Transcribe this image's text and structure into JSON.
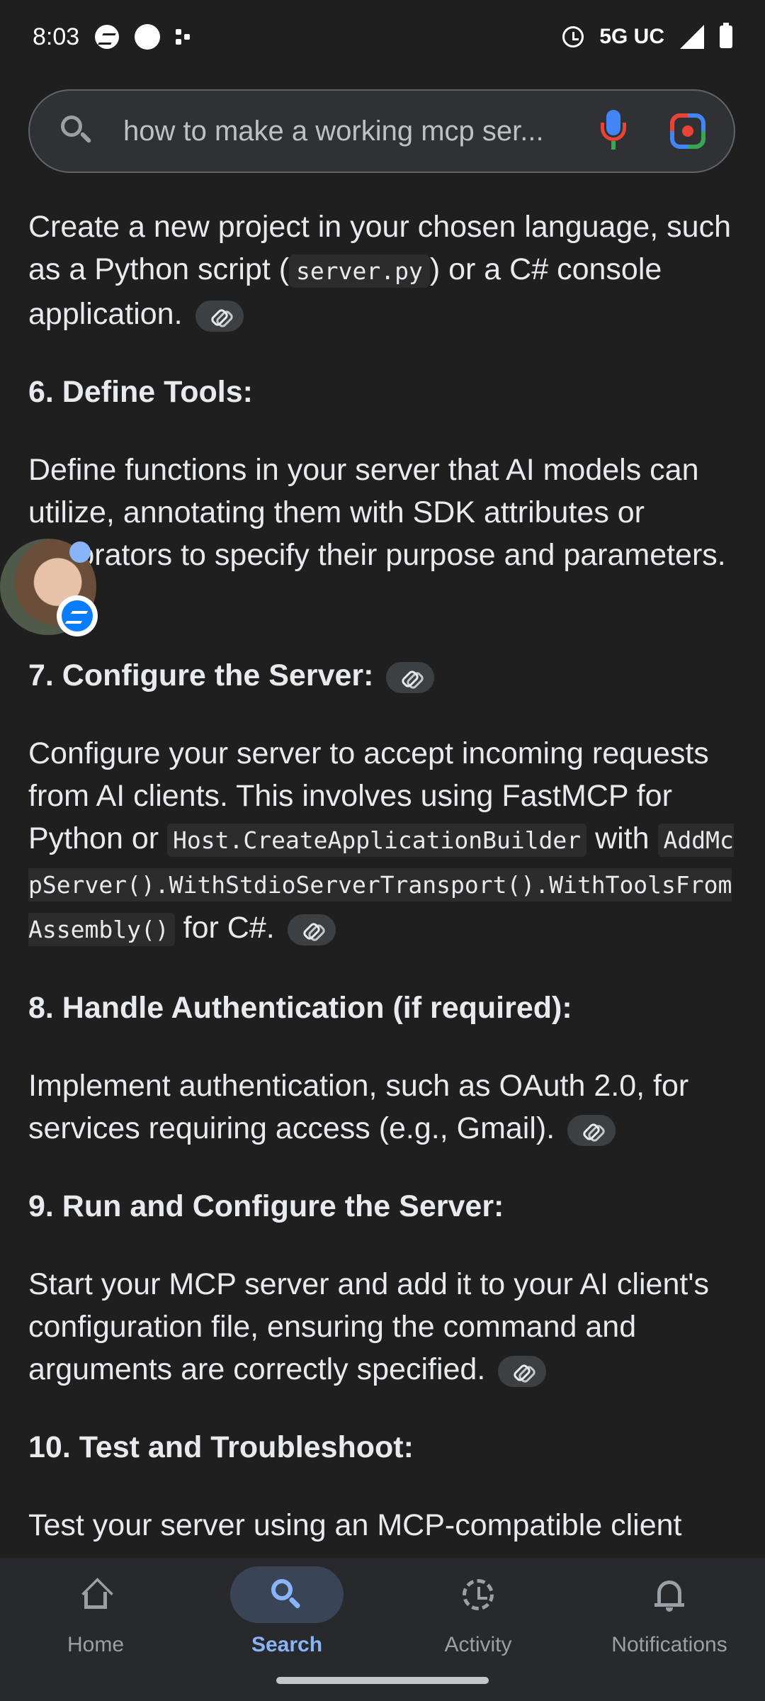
{
  "status_bar": {
    "time": "8:03",
    "network": "5G UC"
  },
  "search": {
    "query": "how to make a working mcp ser..."
  },
  "content": {
    "p5_text_a": "Create a new project in your chosen language, such as a Python script (",
    "p5_code": "server.py",
    "p5_text_b": ") or a C# console application.",
    "h6": "6. Define Tools:",
    "p6": "Define functions in your server that AI models can utilize, annotating them with SDK attributes or decorators to specify their purpose and parameters.",
    "h7": "7. Configure the Server:",
    "p7_text_a": "Configure your server to accept incoming requests from AI clients. This involves using FastMCP for Python or ",
    "p7_code1": "Host.CreateApplicationBuilder",
    "p7_text_b": " with ",
    "p7_code2": "AddMcpServer().WithStdioServerTransport().WithToolsFromAssembly()",
    "p7_text_c": " for C#.",
    "h8": "8. Handle Authentication (if required):",
    "p8": "Implement authentication, such as OAuth 2.0, for services requiring access (e.g., Gmail).",
    "h9": "9. Run and Configure the Server:",
    "p9": "Start your MCP server and add it to your AI client's configuration file, ensuring the command and arguments are correctly specified.",
    "h10": "10. Test and Troubleshoot:",
    "p10": "Test your server using an MCP-compatible client"
  },
  "bottom_nav": {
    "home": "Home",
    "search": "Search",
    "activity": "Activity",
    "notifications": "Notifications",
    "active": "search"
  },
  "colors": {
    "background": "#1f1f1f",
    "accent": "#8ab4f8"
  }
}
